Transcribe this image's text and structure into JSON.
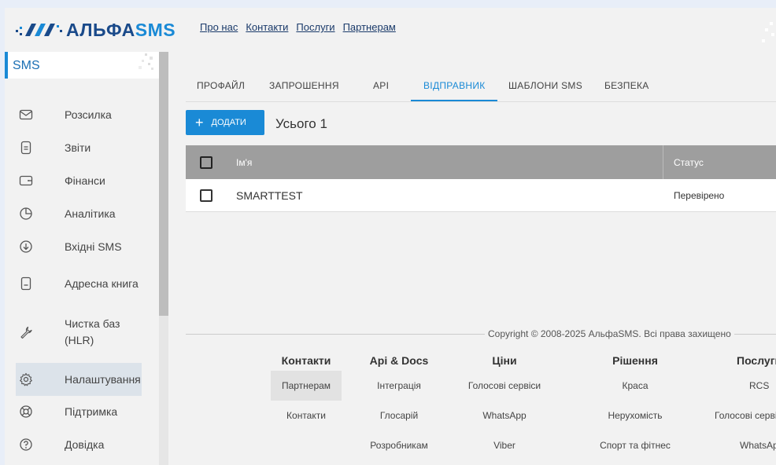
{
  "header": {
    "logo_text_a": "АЛЬФА",
    "logo_text_b": "SMS",
    "nav": [
      "Про нас",
      "Контакти",
      "Послуги",
      "Партнерам"
    ]
  },
  "sidebar": {
    "title": "SMS",
    "items": [
      {
        "label": "Розсилка",
        "icon": "envelope-icon"
      },
      {
        "label": "Звіти",
        "icon": "document-icon"
      },
      {
        "label": "Фінанси",
        "icon": "wallet-icon"
      },
      {
        "label": "Аналітика",
        "icon": "pie-chart-icon"
      },
      {
        "label": "Вхідні SMS",
        "icon": "download-icon"
      },
      {
        "label": "Адресна книга",
        "icon": "address-book-icon"
      },
      {
        "label": "Чистка баз (HLR)",
        "icon": "wrench-icon"
      },
      {
        "label": "Налаштування",
        "icon": "gear-icon"
      },
      {
        "label": "Підтримка",
        "icon": "lifebuoy-icon"
      },
      {
        "label": "Довідка",
        "icon": "help-icon"
      }
    ]
  },
  "tabs": [
    "ПРОФАЙЛ",
    "ЗАПРОШЕННЯ",
    "API",
    "ВІДПРАВНИК",
    "ШАБЛОНИ SMS",
    "БЕЗПЕКА"
  ],
  "active_tab": "ВІДПРАВНИК",
  "toolbar": {
    "add_label": "ДОДАТИ",
    "total_label": "Усього 1"
  },
  "table": {
    "columns": [
      "Ім'я",
      "Статус"
    ],
    "rows": [
      {
        "name": "SMARTTEST",
        "status": "Перевірено"
      }
    ]
  },
  "footer": {
    "copyright": "Copyright © 2008-2025 АльфаSMS. Всі права захищено",
    "columns": [
      {
        "title": "Контакти",
        "links": [
          "Партнерам",
          "Контакти"
        ]
      },
      {
        "title": "Api & Docs",
        "links": [
          "Інтеграція",
          "Глосарій",
          "Розробникам"
        ]
      },
      {
        "title": "Ціни",
        "links": [
          "Голосові сервіси",
          "WhatsApp",
          "Viber"
        ]
      },
      {
        "title": "Рішення",
        "links": [
          "Краса",
          "Нерухомість",
          "Спорт та фітнес"
        ]
      },
      {
        "title": "Послуги",
        "links": [
          "RCS",
          "Голосові сервіси",
          "WhatsApp"
        ]
      }
    ]
  },
  "colors": {
    "accent": "#1a8ad6",
    "table_header": "#9e9e9e",
    "active_item_bg": "#dce3ea"
  }
}
